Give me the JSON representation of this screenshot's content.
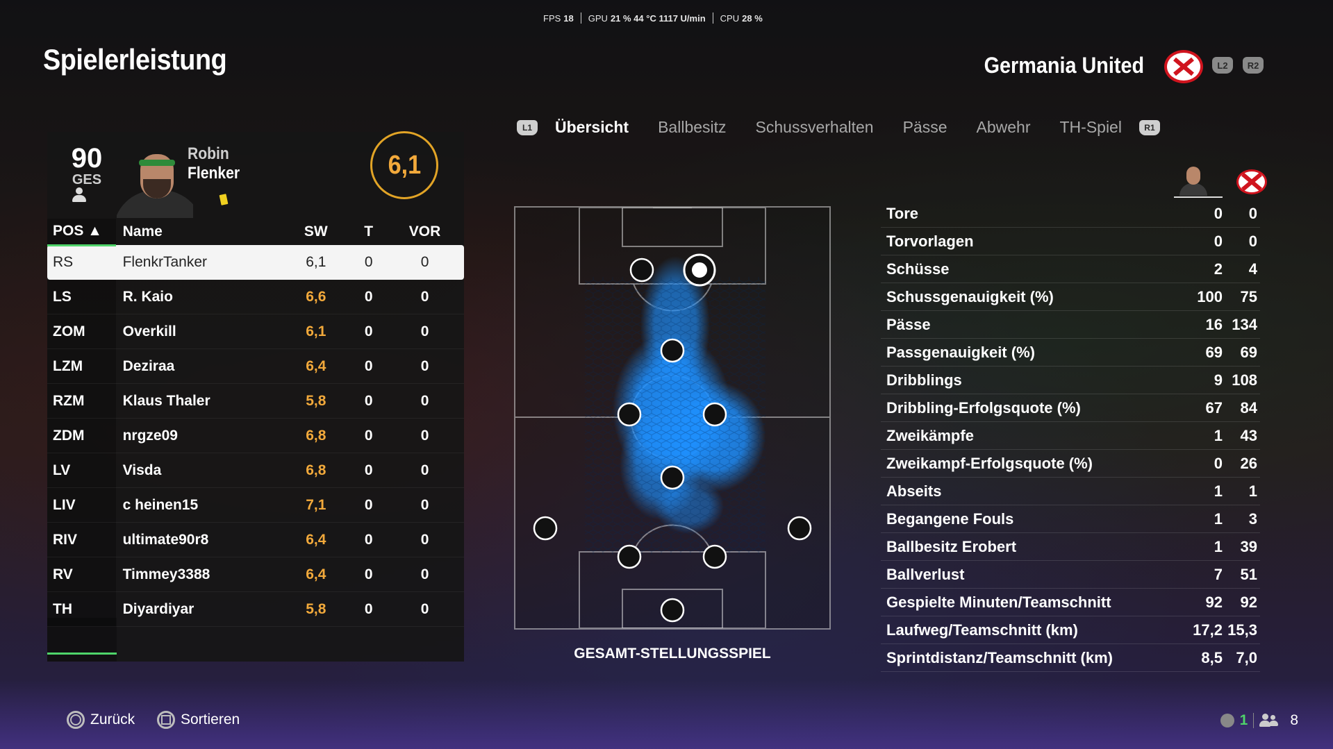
{
  "perf": {
    "fps_label": "FPS",
    "fps_value": "18",
    "gpu_label": "GPU",
    "gpu_value": "21 % 44 °C 1117 U/min",
    "cpu_label": "CPU",
    "cpu_value": "28 %"
  },
  "page_title": "Spielerleistung",
  "team": {
    "name": "Germania United",
    "l2": "L2",
    "r2": "R2"
  },
  "player": {
    "overall": "90",
    "overall_label": "GES",
    "first_name": "Robin",
    "last_name": "Flenker",
    "match_rating": "6,1"
  },
  "table": {
    "headers": {
      "pos": "POS ▲",
      "name": "Name",
      "sw": "SW",
      "t": "T",
      "vor": "VOR"
    },
    "rows": [
      {
        "pos": "RS",
        "name": "FlenkrTanker",
        "sw": "6,1",
        "t": "0",
        "vor": "0"
      },
      {
        "pos": "LS",
        "name": "R. Kaio",
        "sw": "6,6",
        "t": "0",
        "vor": "0"
      },
      {
        "pos": "ZOM",
        "name": "Overkill",
        "sw": "6,1",
        "t": "0",
        "vor": "0"
      },
      {
        "pos": "LZM",
        "name": "Deziraa",
        "sw": "6,4",
        "t": "0",
        "vor": "0"
      },
      {
        "pos": "RZM",
        "name": "Klaus Thaler",
        "sw": "5,8",
        "t": "0",
        "vor": "0"
      },
      {
        "pos": "ZDM",
        "name": "nrgze09",
        "sw": "6,8",
        "t": "0",
        "vor": "0"
      },
      {
        "pos": "LV",
        "name": "Visda",
        "sw": "6,8",
        "t": "0",
        "vor": "0"
      },
      {
        "pos": "LIV",
        "name": "c heinen15",
        "sw": "7,1",
        "t": "0",
        "vor": "0"
      },
      {
        "pos": "RIV",
        "name": "ultimate90r8",
        "sw": "6,4",
        "t": "0",
        "vor": "0"
      },
      {
        "pos": "RV",
        "name": "Timmey3388",
        "sw": "6,4",
        "t": "0",
        "vor": "0"
      },
      {
        "pos": "TH",
        "name": "Diyardiyar",
        "sw": "5,8",
        "t": "0",
        "vor": "0"
      }
    ]
  },
  "tabs": {
    "l1": "L1",
    "r1": "R1",
    "items": [
      "Übersicht",
      "Ballbesitz",
      "Schussverhalten",
      "Pässe",
      "Abwehr",
      "TH-Spiel"
    ],
    "active": "Übersicht"
  },
  "pitch": {
    "label": "GESAMT-STELLUNGSSPIEL"
  },
  "stats": [
    {
      "label": "Tore",
      "player": "0",
      "team": "0"
    },
    {
      "label": "Torvorlagen",
      "player": "0",
      "team": "0"
    },
    {
      "label": "Schüsse",
      "player": "2",
      "team": "4"
    },
    {
      "label": "Schussgenauigkeit (%)",
      "player": "100",
      "team": "75"
    },
    {
      "label": "Pässe",
      "player": "16",
      "team": "134"
    },
    {
      "label": "Passgenauigkeit (%)",
      "player": "69",
      "team": "69"
    },
    {
      "label": "Dribblings",
      "player": "9",
      "team": "108"
    },
    {
      "label": "Dribbling-Erfolgsquote (%)",
      "player": "67",
      "team": "84"
    },
    {
      "label": "Zweikämpfe",
      "player": "1",
      "team": "43"
    },
    {
      "label": "Zweikampf-Erfolgsquote (%)",
      "player": "0",
      "team": "26"
    },
    {
      "label": "Abseits",
      "player": "1",
      "team": "1"
    },
    {
      "label": "Begangene Fouls",
      "player": "1",
      "team": "3"
    },
    {
      "label": "Ballbesitz Erobert",
      "player": "1",
      "team": "39"
    },
    {
      "label": "Ballverlust",
      "player": "7",
      "team": "51"
    },
    {
      "label": "Gespielte Minuten/Teamschnitt",
      "player": "92",
      "team": "92"
    },
    {
      "label": "Laufweg/Teamschnitt (km)",
      "player": "17,2",
      "team": "15,3"
    },
    {
      "label": "Sprintdistanz/Teamschnitt (km)",
      "player": "8,5",
      "team": "7,0"
    }
  ],
  "footer": {
    "back": "Zurück",
    "sort": "Sortieren",
    "count_a": "1",
    "count_b": "8"
  },
  "colors": {
    "accent_green": "#4fd46a",
    "rating_orange": "#f2a93b",
    "heatmap_blue": "#1e90ff"
  }
}
